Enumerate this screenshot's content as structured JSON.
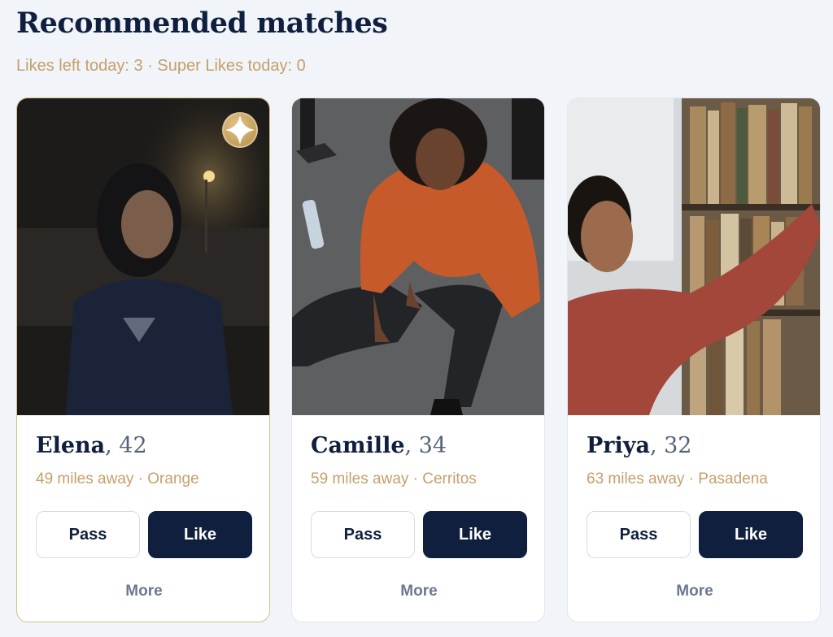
{
  "page": {
    "title": "Recommended matches",
    "subtitle": "Likes left today: 3 · Super Likes today: 0"
  },
  "colors": {
    "navy": "#0f1f3d",
    "gold": "#c4a06a",
    "background": "#f1f4f9"
  },
  "cards": [
    {
      "name": "Elena",
      "age": ", 42",
      "location": "49 miles away · Orange",
      "pass_label": "Pass",
      "like_label": "Like",
      "more_label": "More",
      "super_like_badge": "sparkle-icon",
      "photo": "woman-smiling-at-night-photo"
    },
    {
      "name": "Camille",
      "age": ", 34",
      "location": "59 miles away · Cerritos",
      "pass_label": "Pass",
      "like_label": "Like",
      "more_label": "More",
      "photo": "woman-sitting-on-gym-floor-photo"
    },
    {
      "name": "Priya",
      "age": ", 32",
      "location": "63 miles away · Pasadena",
      "pass_label": "Pass",
      "like_label": "Like",
      "more_label": "More",
      "photo": "woman-reaching-bookshelf-photo"
    }
  ]
}
